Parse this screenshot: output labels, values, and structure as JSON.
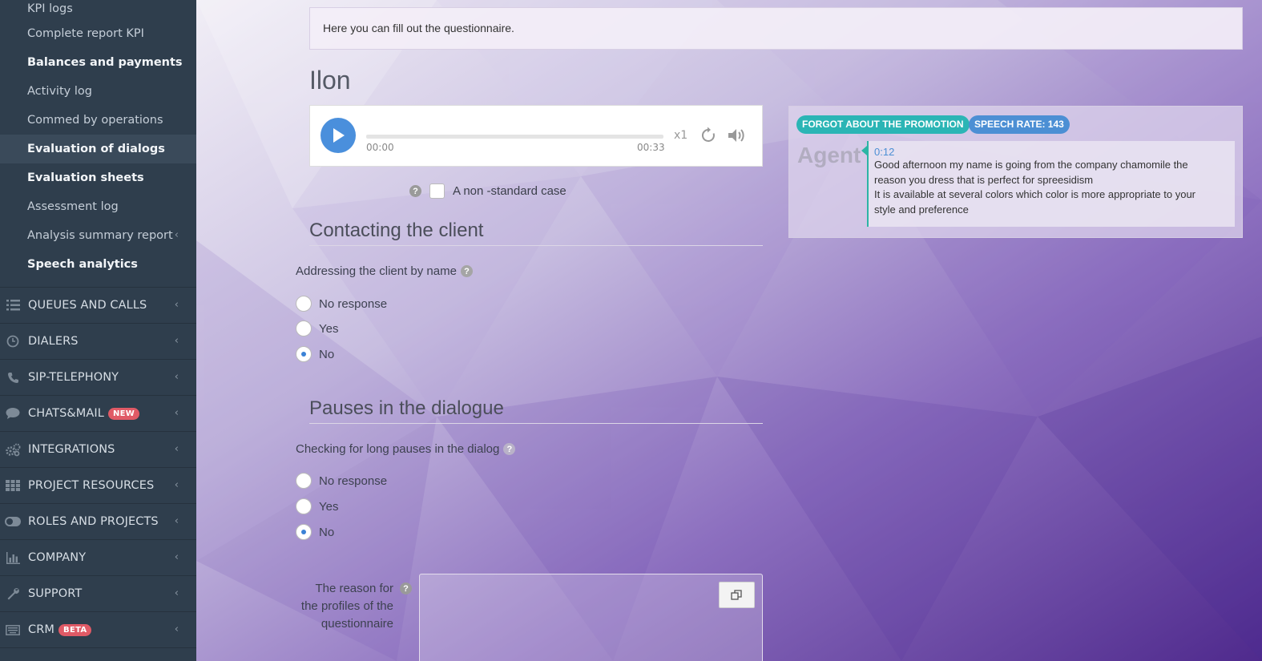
{
  "sidebar": {
    "sub_items": [
      {
        "label": "KPI logs",
        "bold": false
      },
      {
        "label": "Complete report KPI",
        "bold": false
      },
      {
        "label": "Balances and payments",
        "bold": true
      },
      {
        "label": "Activity log",
        "bold": false
      },
      {
        "label": "Commed by operations",
        "bold": false
      },
      {
        "label": "Evaluation of dialogs",
        "bold": true,
        "active": true
      },
      {
        "label": "Evaluation sheets",
        "bold": true
      },
      {
        "label": "Assessment log",
        "bold": false
      },
      {
        "label": "Analysis summary report",
        "bold": false,
        "has_chevron": true
      },
      {
        "label": "Speech analytics",
        "bold": true
      }
    ],
    "nav_items": [
      {
        "label": "QUEUES AND CALLS",
        "icon": "list-icon"
      },
      {
        "label": "DIALERS",
        "icon": "clock-icon"
      },
      {
        "label": "SIP-TELEPHONY",
        "icon": "phone-icon"
      },
      {
        "label": "CHATS&MAIL",
        "icon": "chat-icon",
        "badge": "NEW"
      },
      {
        "label": "INTEGRATIONS",
        "icon": "gears-icon"
      },
      {
        "label": "PROJECT RESOURCES",
        "icon": "grid-icon"
      },
      {
        "label": "ROLES AND PROJECTS",
        "icon": "toggle-icon"
      },
      {
        "label": "COMPANY",
        "icon": "bar-chart-icon"
      },
      {
        "label": "SUPPORT",
        "icon": "wrench-icon"
      },
      {
        "label": "CRM",
        "icon": "keyboard-icon",
        "badge": "BETA"
      }
    ]
  },
  "main": {
    "notice": "Here you can fill out the questionnaire.",
    "agent_name": "Ilon",
    "player": {
      "current_time": "00:00",
      "duration": "00:33",
      "speed": "x1",
      "progress": 0
    },
    "non_standard_case_label": "A non -standard case",
    "sections": [
      {
        "title": "Contacting the client",
        "question": "Addressing the client by name",
        "options": [
          "No response",
          "Yes",
          "No"
        ],
        "selected": "No"
      },
      {
        "title": "Pauses in the dialogue",
        "question": "Checking for long pauses in the dialog",
        "options": [
          "No response",
          "Yes",
          "No"
        ],
        "selected": "No"
      }
    ],
    "reason_label": "The reason for the profiles of the questionnaire"
  },
  "transcript": {
    "tags": [
      "FORGOT ABOUT THE PROMOTION",
      "SPEECH RATE: 143"
    ],
    "speaker": "Agent",
    "time": "0:12",
    "lines": [
      "Good afternoon my name is going from the company chamomile the",
      "reason you dress that is perfect for spreesidism",
      "It is available at several colors which color is more appropriate to your",
      "style and preference"
    ]
  },
  "colors": {
    "sidebar_bg": "#2f3e4d",
    "accent_blue": "#4a8fdc",
    "teal_tag": "#2bb5b5",
    "badge_red": "#e05a66"
  }
}
